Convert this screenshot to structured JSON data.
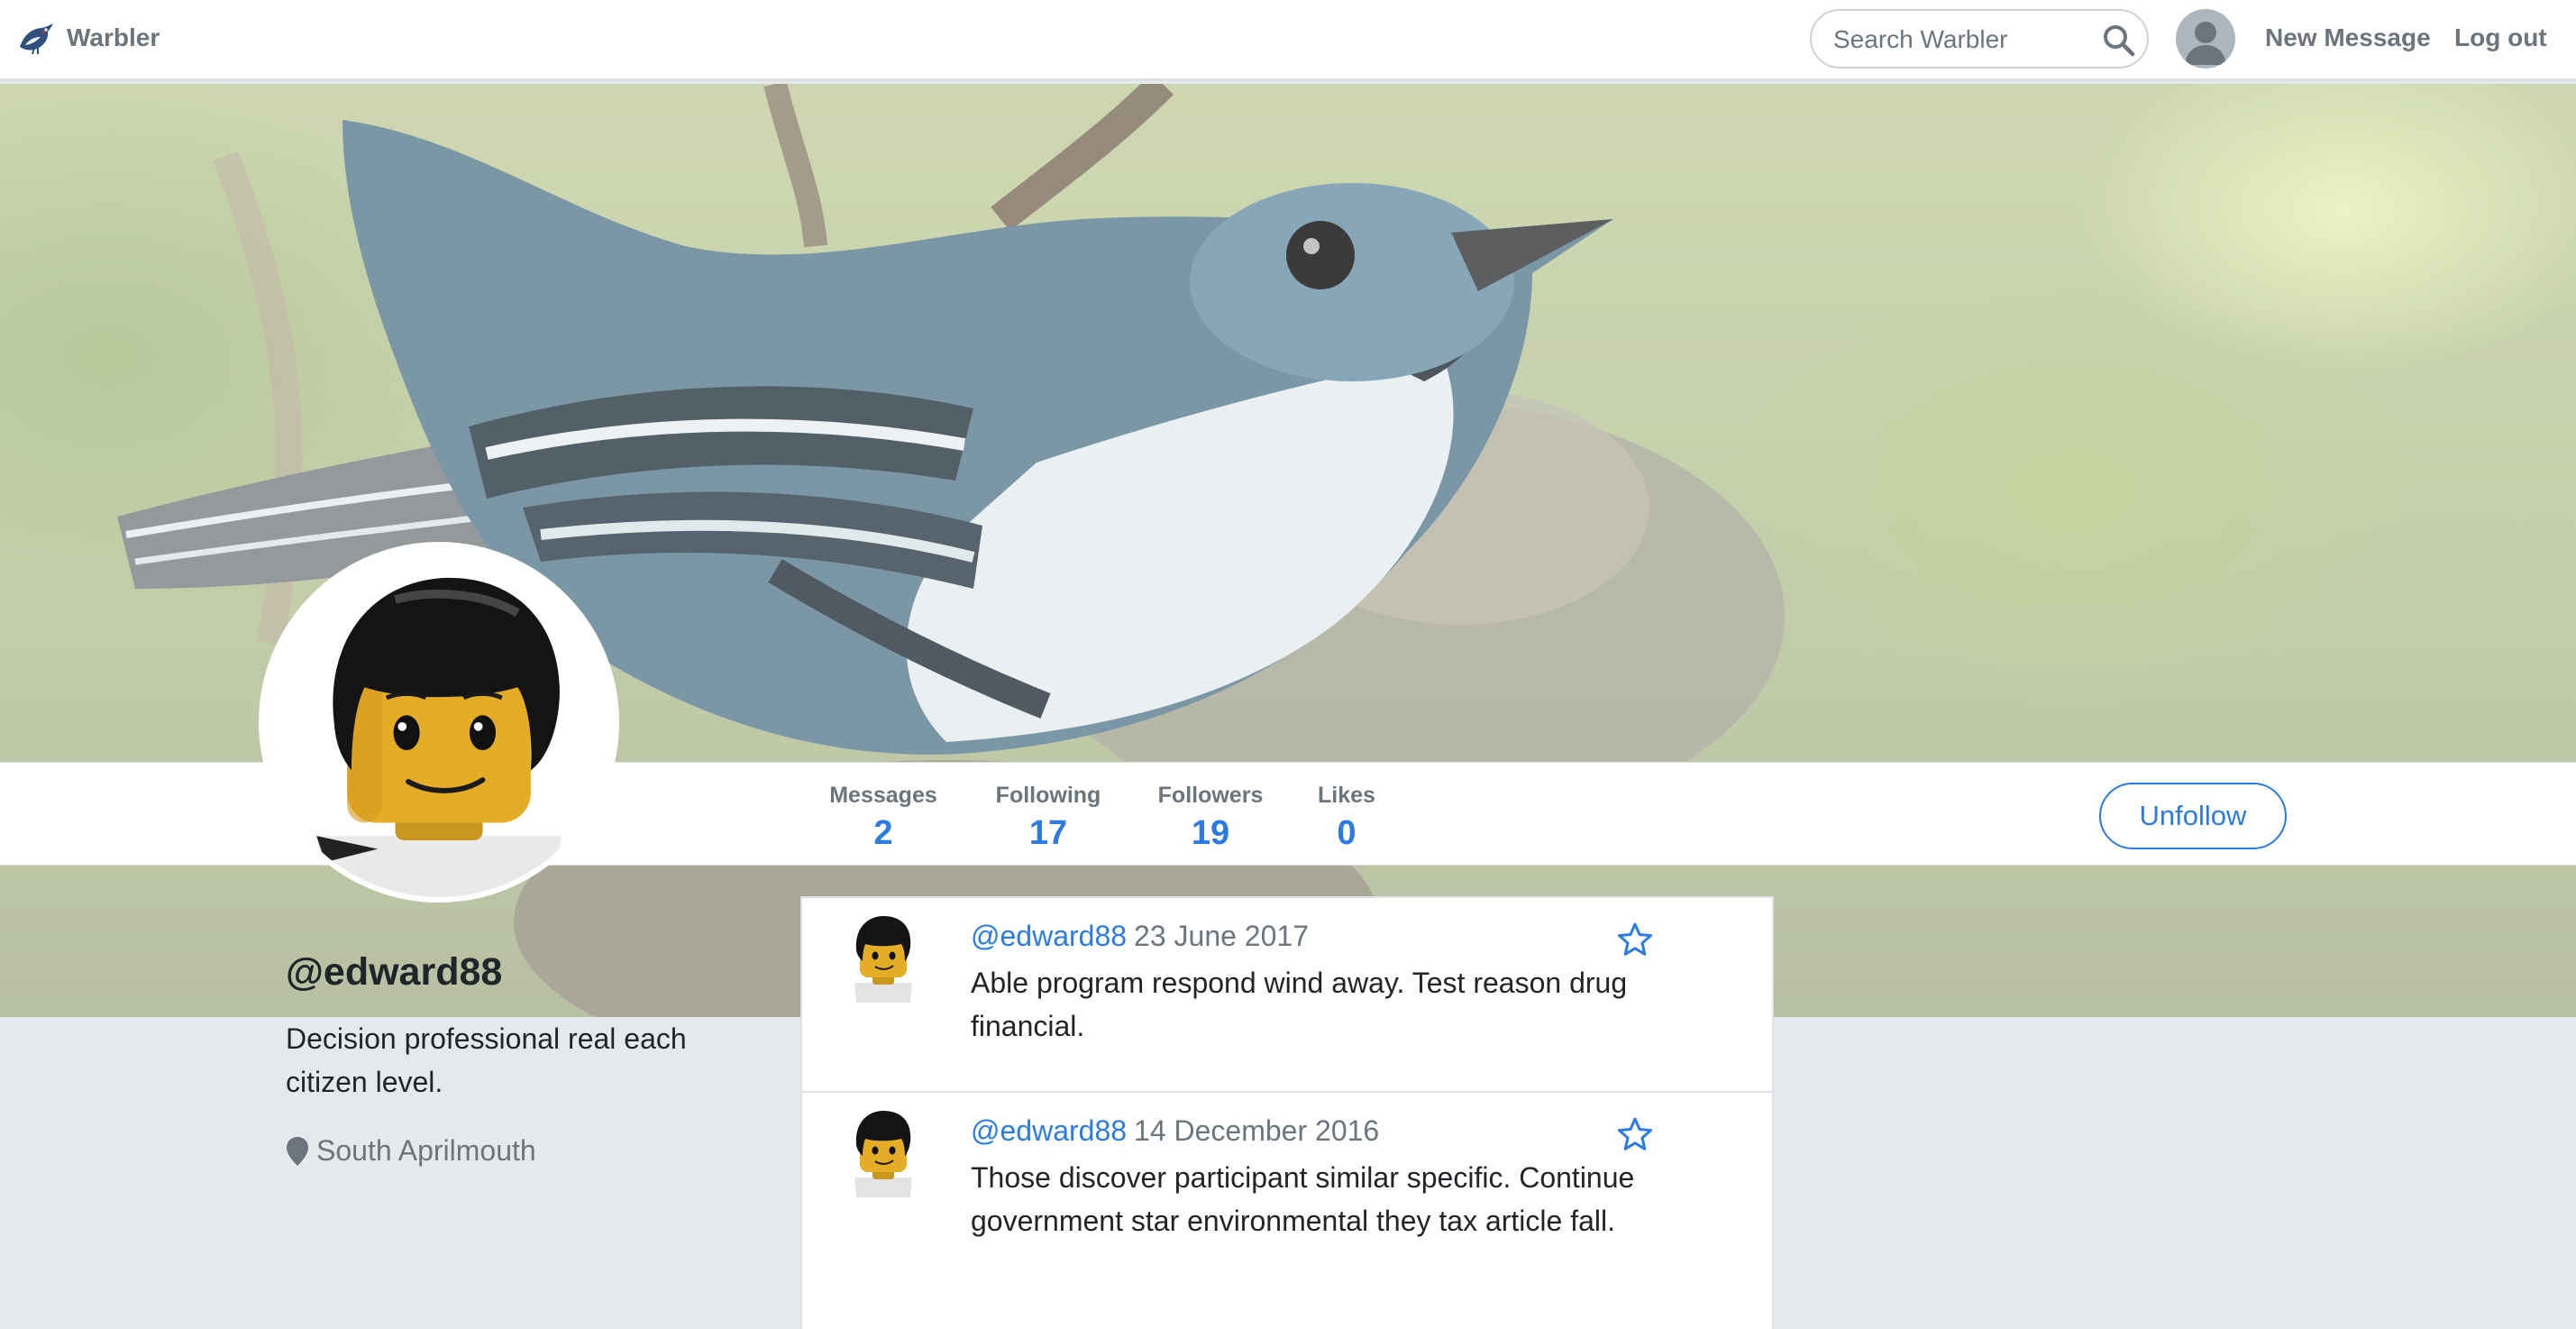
{
  "navbar": {
    "brand": "Warbler",
    "search_placeholder": "Search Warbler",
    "new_message": "New Message",
    "logout": "Log out"
  },
  "profile": {
    "username": "@edward88",
    "bio": "Decision professional real each citizen level.",
    "location": "South Aprilmouth"
  },
  "stats": {
    "messages": {
      "label": "Messages",
      "value": "2"
    },
    "following": {
      "label": "Following",
      "value": "17"
    },
    "followers": {
      "label": "Followers",
      "value": "19"
    },
    "likes": {
      "label": "Likes",
      "value": "0"
    }
  },
  "actions": {
    "unfollow": "Unfollow"
  },
  "messages": [
    {
      "user": "@edward88",
      "date": "23 June 2017",
      "text": "Able program respond wind away. Test reason drug financial."
    },
    {
      "user": "@edward88",
      "date": "14 December 2016",
      "text": "Those discover participant similar specific. Continue government star environmental they tax article fall."
    }
  ],
  "colors": {
    "accent": "#2c7be5",
    "muted": "#6c757d",
    "page_bg": "#e6e9ec"
  },
  "icons": {
    "logo": "warbler-bird-icon",
    "search": "search-icon",
    "star": "star-outline-icon",
    "location": "map-pin-icon"
  }
}
